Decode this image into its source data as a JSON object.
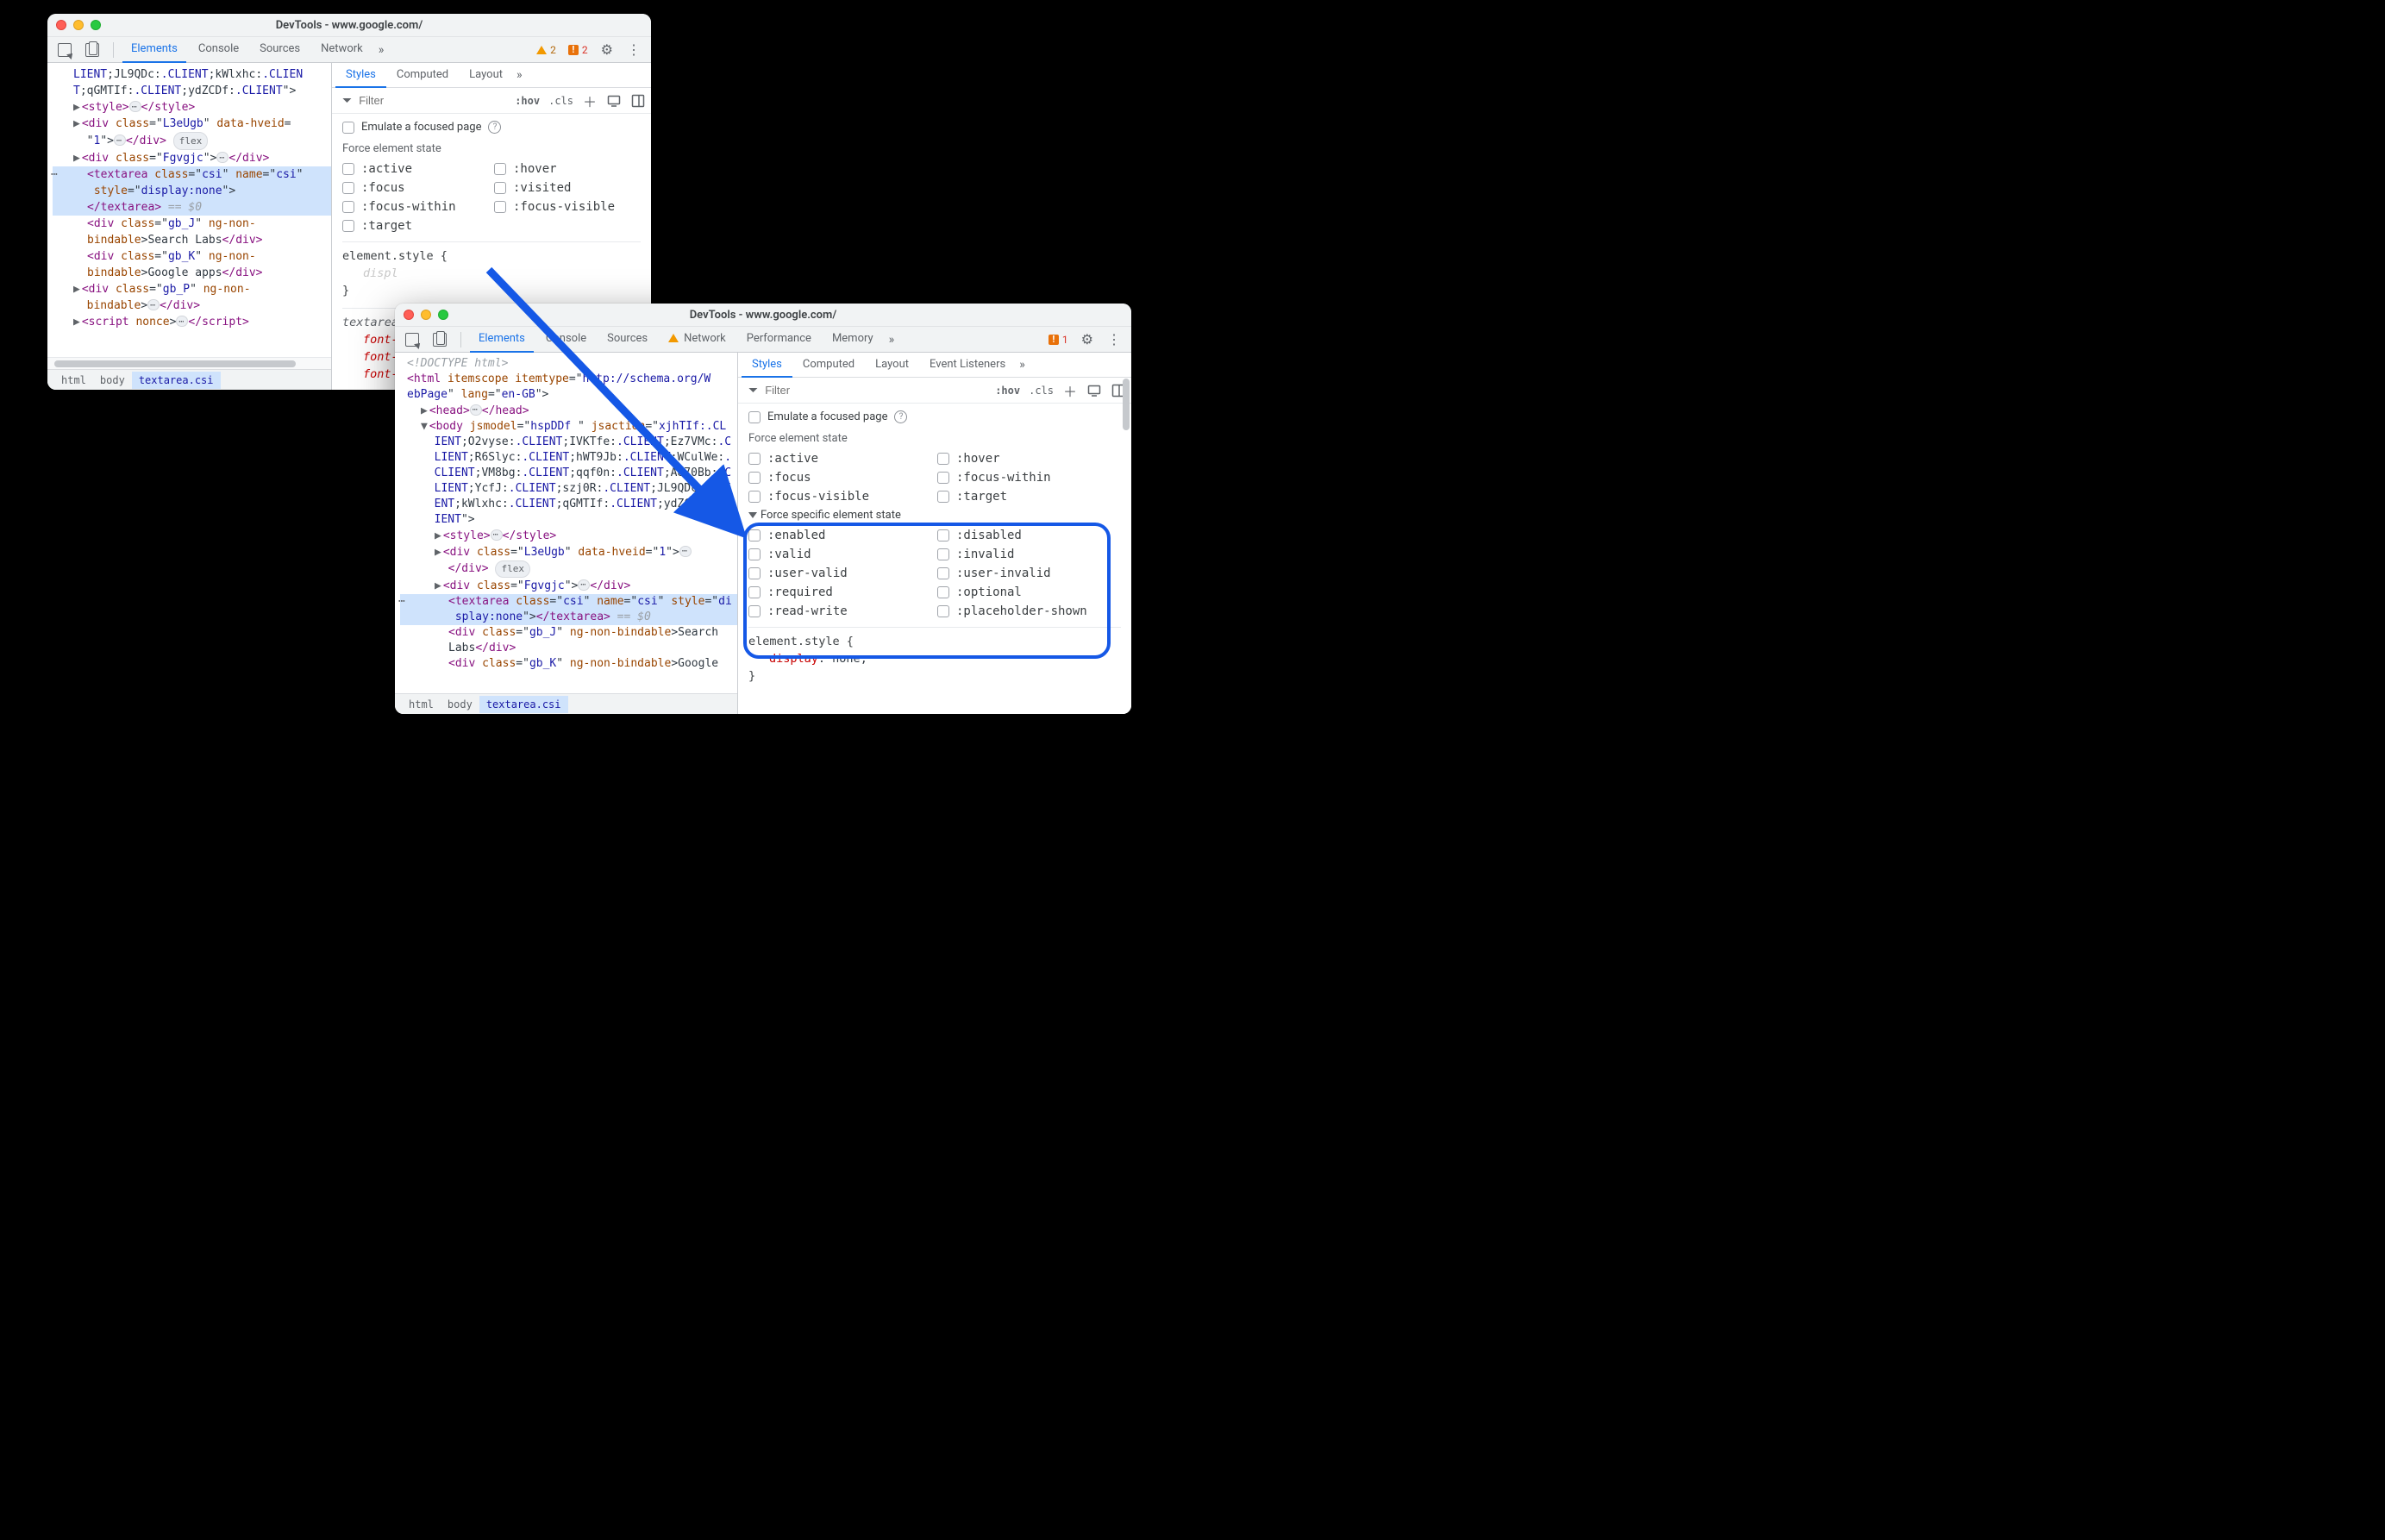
{
  "window1": {
    "title": "DevTools - www.google.com/",
    "tabs": [
      "Elements",
      "Console",
      "Sources",
      "Network"
    ],
    "active_tab": "Elements",
    "warn_count": "2",
    "err_count": "2",
    "breadcrumbs": [
      "html",
      "body",
      "textarea.csi"
    ],
    "dom": {
      "l0": "LIENT;JL9QDc:.CLIENT;kWlxhc:.CLIEN\nT;qGMTIf:.CLIENT;ydZCDf:.CLIENT\">",
      "style_open": "<style>",
      "style_close": "</style>",
      "div1_open": "<div class=\"L3eUgb\" data-hveid=\n\"1\">",
      "div1_close": "</div>",
      "flex_label": "flex",
      "div2_open": "<div class=\"Fgvgjc\">",
      "div2_close": "</div>",
      "ta_open": "<textarea class=\"csi\" name=\"csi\"\n style=\"display:none\">",
      "ta_close": "</textarea>",
      "eqdol": " == $0",
      "div3": "<div class=\"gb_J\" ng-non-\nbindable>Search Labs</div>",
      "div4": "<div class=\"gb_K\" ng-non-\nbindable>Google apps</div>",
      "div5_open": "<div class=\"gb_P\" ng-non-\nbindable>",
      "div5_close": "</div>",
      "script_open": "<script nonce>",
      "script_close": "</script>"
    },
    "side": {
      "tabs": [
        "Styles",
        "Computed",
        "Layout"
      ],
      "active": "Styles",
      "filter_placeholder": "Filter",
      "hov": ":hov",
      "cls": ".cls",
      "emulate_label": "Emulate a focused page",
      "force_label": "Force element state",
      "states_left": [
        ":active",
        ":focus",
        ":focus-within",
        ":target"
      ],
      "states_right": [
        ":hover",
        ":visited",
        ":focus-visible"
      ],
      "rule1_sel": "element.style {",
      "rule1_prop": "displ",
      "rule1_close": "}",
      "rule2_sel": "textarea",
      "rule2_props": [
        "font-",
        "font-",
        "font-"
      ]
    }
  },
  "window2": {
    "title": "DevTools - www.google.com/",
    "tabs": [
      "Elements",
      "Console",
      "Sources",
      "Network",
      "Performance",
      "Memory"
    ],
    "active_tab": "Elements",
    "err_count": "1",
    "breadcrumbs": [
      "html",
      "body",
      "textarea.csi"
    ],
    "dom": {
      "doctype": "<!DOCTYPE html>",
      "html_open": "<html itemscope itemtype=\"http://schema.org/W\nebPage\" lang=\"en-GB\">",
      "head": "<head>",
      "head_close": "</head>",
      "body_open": "<body jsmodel=\"hspDDf \" jsaction=\"xjhTIf:.CL\nIENT;O2vyse:.CLIENT;IVKTfe:.CLIENT;Ez7VMc:.C\nLIENT;R6Slyc:.CLIENT;hWT9Jb:.CLIENT;WCulWe:.\nCLIENT;VM8bg:.CLIENT;qqf0n:.CLIENT;A870Bb:.C\nLIENT;YcfJ:.CLIENT;szj0R:.CLIENT;JL9QDc:.CLI\nENT;kWlxhc:.CLIENT;qGMTIf:.CLIENT;ydZCDf:.CL\nIENT\">",
      "style_open": "<style>",
      "style_close": "</style>",
      "div1_open": "<div class=\"L3eUgb\" data-hveid=\"1\">",
      "div1_close": "</div>",
      "flex_label": "flex",
      "div2_open": "<div class=\"Fgvgjc\">",
      "div2_close": "</div>",
      "ta_open": "<textarea class=\"csi\" name=\"csi\" style=\"di\nsplay:none\"></textarea>",
      "eqdol": " == $0",
      "div3": "<div class=\"gb_J\" ng-non-bindable>Search \nLabs</div>",
      "div4": "<div class=\"gb_K\" ng-non-bindable>Google"
    },
    "side": {
      "tabs": [
        "Styles",
        "Computed",
        "Layout",
        "Event Listeners"
      ],
      "active": "Styles",
      "filter_placeholder": "Filter",
      "hov": ":hov",
      "cls": ".cls",
      "emulate_label": "Emulate a focused page",
      "force_label": "Force element state",
      "states_left": [
        ":active",
        ":focus",
        ":focus-visible"
      ],
      "states_right": [
        ":hover",
        ":focus-within",
        ":target"
      ],
      "specific_label": "Force specific element state",
      "spec_left": [
        ":enabled",
        ":valid",
        ":user-valid",
        ":required",
        ":read-write"
      ],
      "spec_right": [
        ":disabled",
        ":invalid",
        ":user-invalid",
        ":optional",
        ":placeholder-shown"
      ],
      "rule1_sel": "element.style {",
      "rule1_prop_name": "display",
      "rule1_prop_val": "none",
      "rule1_close": "}"
    }
  }
}
